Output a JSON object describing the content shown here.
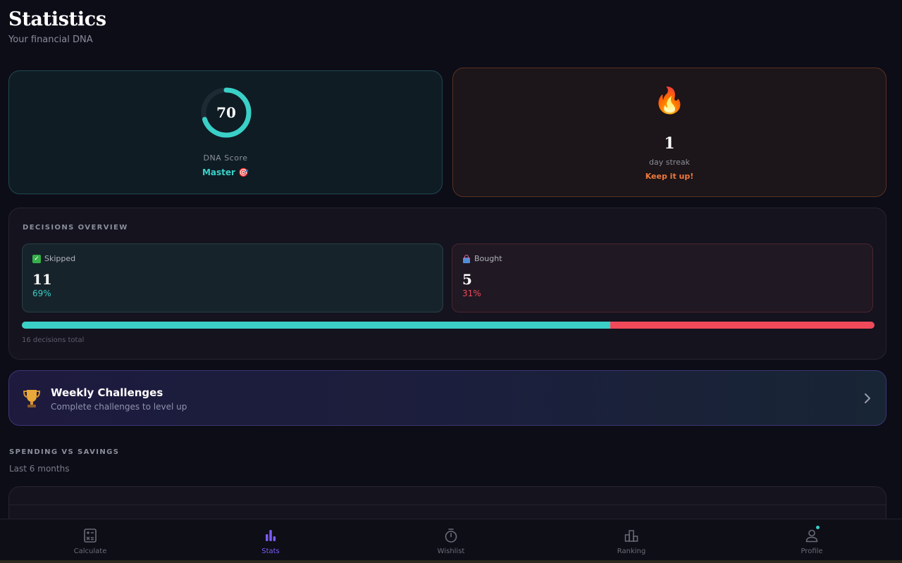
{
  "header": {
    "title": "Statistics",
    "subtitle": "Your financial DNA"
  },
  "dna": {
    "score": "70",
    "score_fraction": 0.7,
    "label": "DNA Score",
    "level": "Master 🎯"
  },
  "streak": {
    "icon": "fire-icon",
    "value": "1",
    "label": "day streak",
    "cheer": "Keep it up!"
  },
  "decisions": {
    "heading": "DECISIONS OVERVIEW",
    "skipped": {
      "label": "Skipped",
      "count": "11",
      "percent": "69%"
    },
    "bought": {
      "label": "Bought",
      "count": "5",
      "percent": "31%"
    },
    "skipped_fraction": 0.69,
    "total": "16 decisions total"
  },
  "challenges": {
    "title": "Weekly Challenges",
    "subtitle": "Complete challenges to level up"
  },
  "spending": {
    "heading": "SPENDING VS SAVINGS",
    "subtitle": "Last 6 months"
  },
  "tabs": [
    {
      "label": "Calculate",
      "icon": "calculator-icon",
      "active": false
    },
    {
      "label": "Stats",
      "icon": "bar-chart-icon",
      "active": true
    },
    {
      "label": "Wishlist",
      "icon": "stopwatch-icon",
      "active": false
    },
    {
      "label": "Ranking",
      "icon": "ranking-icon",
      "active": false
    },
    {
      "label": "Profile",
      "icon": "user-icon",
      "active": false
    }
  ],
  "colors": {
    "accent_teal": "#3ad0c8",
    "accent_red": "#f04a5a",
    "accent_orange": "#f07a3a",
    "accent_purple": "#7a5cf5"
  }
}
